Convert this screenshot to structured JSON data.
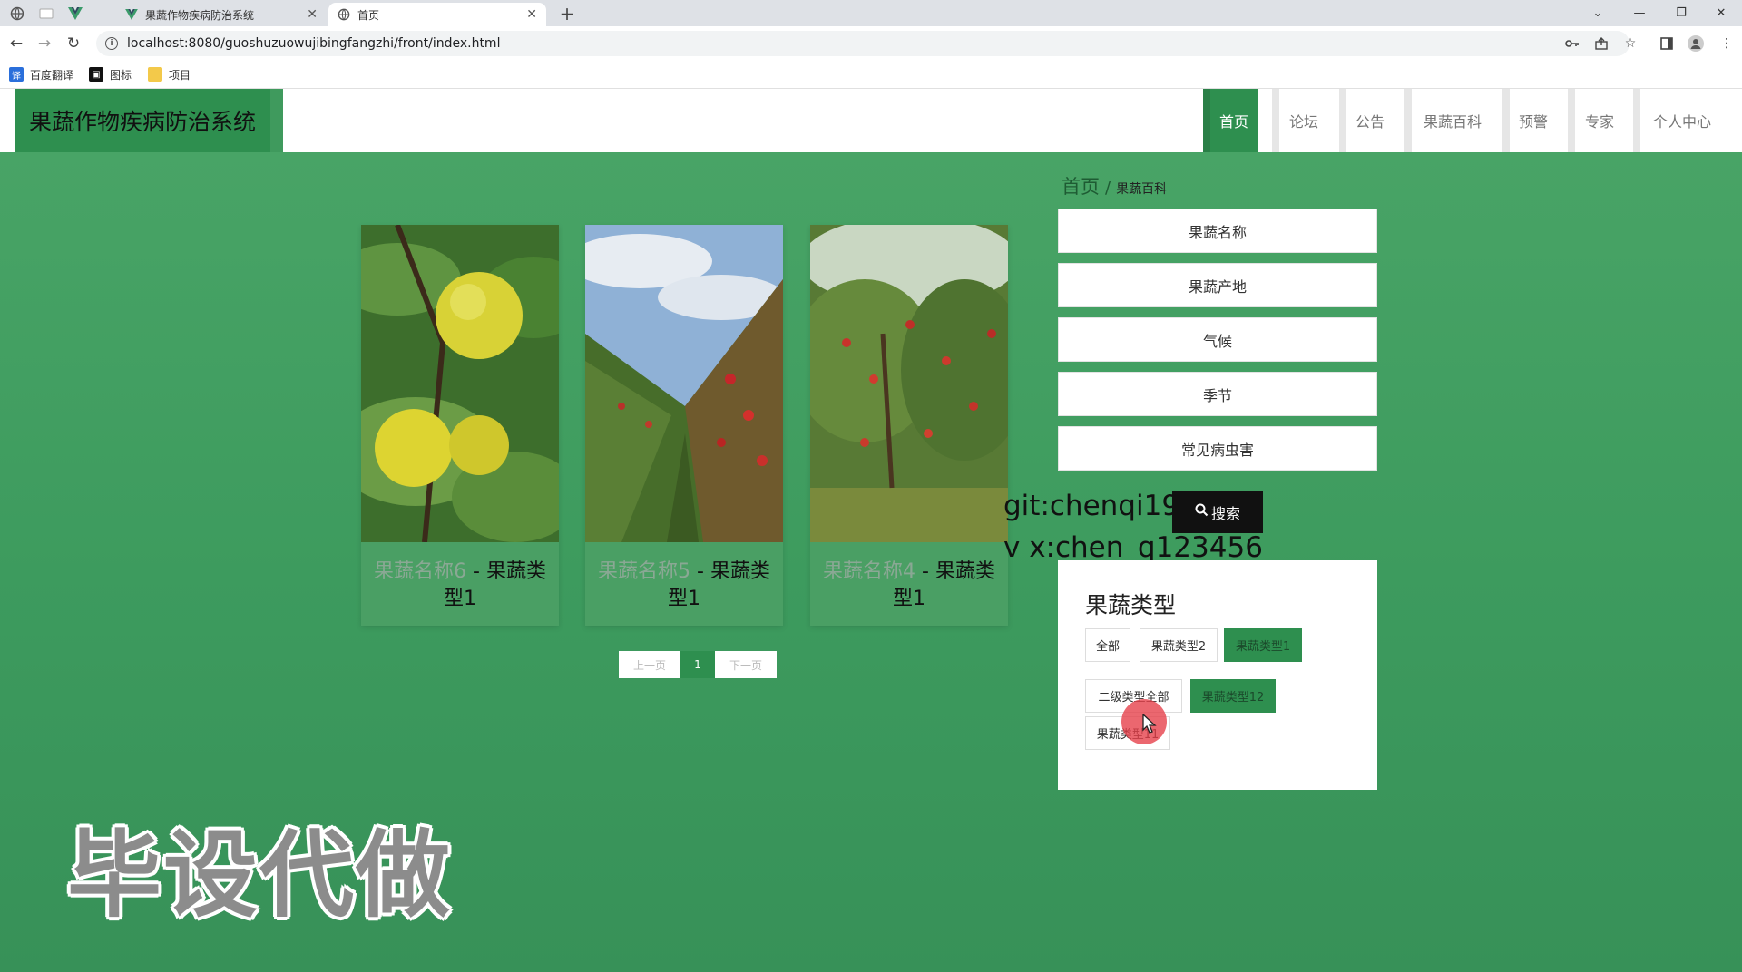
{
  "browser": {
    "tabs": [
      {
        "title": "果蔬作物疾病防治系统",
        "active": false
      },
      {
        "title": "首页",
        "active": true
      }
    ],
    "url": "localhost:8080/guoshuzuowujibingfangzhi/front/index.html",
    "bookmarks": [
      "百度翻译",
      "图标",
      "项目"
    ]
  },
  "site": {
    "logo": "果蔬作物疾病防治系统",
    "nav": [
      "首页",
      "论坛",
      "公告",
      "果蔬百科",
      "预警",
      "专家",
      "个人中心"
    ]
  },
  "cards": [
    {
      "name": "果蔬名称6",
      "sep": " - ",
      "type": "果蔬类型1"
    },
    {
      "name": "果蔬名称5",
      "sep": " - ",
      "type": "果蔬类型1"
    },
    {
      "name": "果蔬名称4",
      "sep": " - ",
      "type": "果蔬类型1"
    }
  ],
  "pager": {
    "prev": "上一页",
    "page": "1",
    "next": "下一页"
  },
  "breadcrumb": {
    "home": "首页",
    "sep": "/",
    "current": "果蔬百科"
  },
  "search_fields": [
    "果蔬名称",
    "果蔬产地",
    "气候",
    "季节",
    "常见病虫害"
  ],
  "search_button": "搜索",
  "category": {
    "title": "果蔬类型",
    "chips": [
      "全部",
      "果蔬类型2",
      "果蔬类型1",
      "二级类型全部",
      "果蔬类型12",
      "果蔬类型11"
    ]
  },
  "watermark": {
    "line1": "git:chenqi199",
    "line2": "v x:chen_q123456",
    "big": "毕设代做"
  },
  "colors": {
    "primary": "#2e8f4f",
    "background": "#3f9a5d"
  }
}
